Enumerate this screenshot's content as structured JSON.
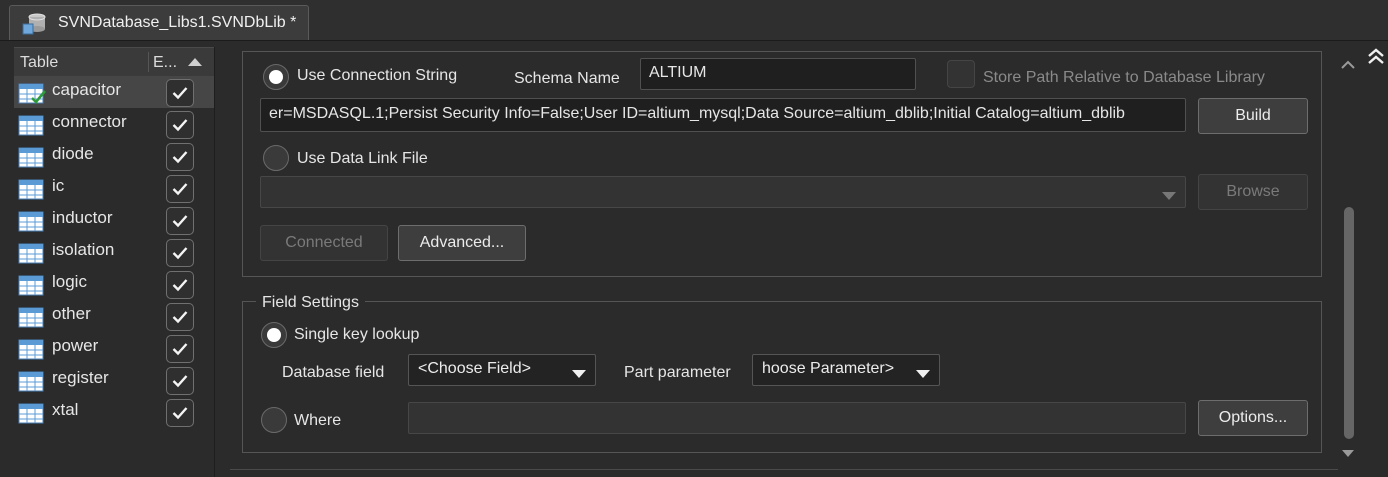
{
  "window": {
    "tab_title": "SVNDatabase_Libs1.SVNDbLib *",
    "tab_icon": "database-library-icon"
  },
  "table_panel": {
    "col_table": "Table",
    "col_enabled": "E...",
    "rows": [
      {
        "name": "capacitor",
        "enabled": true,
        "selected": true
      },
      {
        "name": "connector",
        "enabled": true
      },
      {
        "name": "diode",
        "enabled": true
      },
      {
        "name": "ic",
        "enabled": true
      },
      {
        "name": "inductor",
        "enabled": true
      },
      {
        "name": "isolation",
        "enabled": true
      },
      {
        "name": "logic",
        "enabled": true
      },
      {
        "name": "other",
        "enabled": true
      },
      {
        "name": "power",
        "enabled": true
      },
      {
        "name": "register",
        "enabled": true
      },
      {
        "name": "xtal",
        "enabled": true
      }
    ]
  },
  "connection": {
    "use_conn_string_label": "Use Connection String",
    "use_conn_string_selected": true,
    "schema_name_label": "Schema Name",
    "schema_name_value": "ALTIUM",
    "store_path_label": "Store Path Relative to Database Library",
    "connection_string": "er=MSDASQL.1;Persist Security Info=False;User ID=altium_mysql;Data Source=altium_dblib;Initial Catalog=altium_dblib",
    "build_label": "Build",
    "use_data_link_label": "Use Data Link File",
    "use_data_link_selected": false,
    "data_link_value": "",
    "browse_label": "Browse",
    "connected_label": "Connected",
    "advanced_label": "Advanced..."
  },
  "field_settings": {
    "legend": "Field Settings",
    "single_key_label": "Single key lookup",
    "single_key_selected": true,
    "database_field_label": "Database field",
    "database_field_value": "<Choose Field>",
    "part_parameter_label": "Part parameter",
    "part_parameter_value": "hoose Parameter>",
    "where_label": "Where",
    "where_selected": false,
    "where_value": "",
    "options_label": "Options..."
  },
  "colors": {
    "background": "#2b2b2b",
    "text": "#e6e6e6",
    "disabled_text": "#8a8a8a",
    "table_icon_blue": "#5b9bd5"
  }
}
